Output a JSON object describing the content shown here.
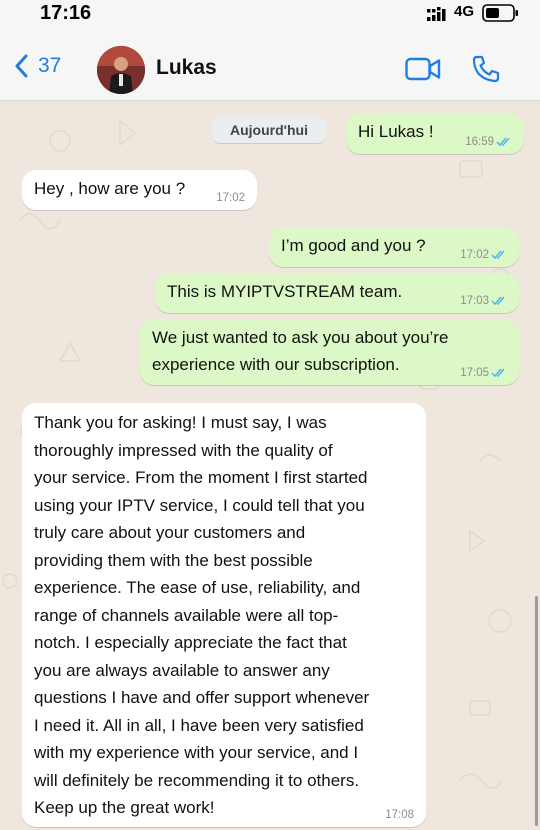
{
  "status_bar": {
    "time": "17:16",
    "network": "4G"
  },
  "header": {
    "back_count": "37",
    "contact_name": "Lukas"
  },
  "chat": {
    "date_chip": "Aujourd'hui",
    "messages": [
      {
        "direction": "out",
        "lines": [
          "Hi Lukas !"
        ],
        "time": "16:59",
        "read": true
      },
      {
        "direction": "in",
        "lines": [
          "Hey , how are you ?"
        ],
        "time": "17:02"
      },
      {
        "direction": "out",
        "lines": [
          "I’m good and you ?"
        ],
        "time": "17:02",
        "read": true
      },
      {
        "direction": "out",
        "lines": [
          "This is MYIPTVSTREAM team."
        ],
        "time": "17:03",
        "read": true
      },
      {
        "direction": "out",
        "lines": [
          "We just wanted to ask you about you’re",
          "experience with our subscription."
        ],
        "time": "17:05",
        "read": true
      },
      {
        "direction": "in",
        "lines": [
          "Thank you for asking! I must say, I was",
          "thoroughly impressed with the quality of",
          "your service. From the moment I first started",
          "using your IPTV service, I could tell that you",
          "truly care about your customers and",
          "providing them with the best possible",
          "experience. The ease of use, reliability, and",
          "range of channels available were all top-",
          "notch. I especially appreciate the fact that",
          "you are always available to answer any",
          "questions I have and offer support whenever",
          "I need it. All in all, I have been very satisfied",
          "with my experience with your service, and I",
          "will definitely be recommending it to others.",
          "Keep up the great work!"
        ],
        "time": "17:08"
      }
    ]
  },
  "colors": {
    "accent": "#1f7de4",
    "outgoing_bubble": "#dcf8c6",
    "incoming_bubble": "#ffffff",
    "read_ticks": "#4fb6ec",
    "chat_background": "#efe7dd"
  },
  "icons": [
    "chevron-left-icon",
    "video-camera-icon",
    "phone-icon",
    "signal-icon",
    "battery-icon",
    "double-check-icon"
  ]
}
